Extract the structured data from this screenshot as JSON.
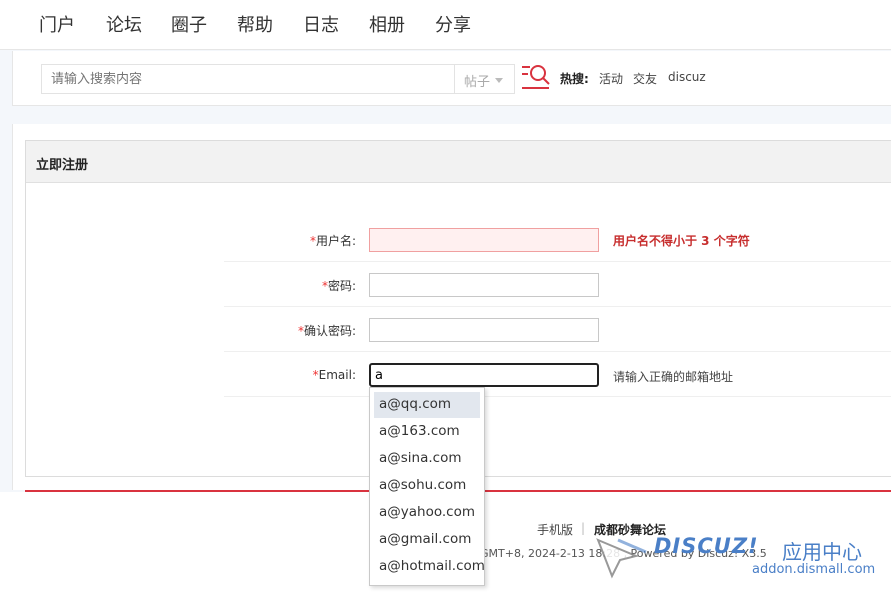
{
  "nav": {
    "items": [
      {
        "label": "门户"
      },
      {
        "label": "论坛"
      },
      {
        "label": "圈子"
      },
      {
        "label": "帮助"
      },
      {
        "label": "日志"
      },
      {
        "label": "相册"
      },
      {
        "label": "分享"
      }
    ]
  },
  "search": {
    "placeholder": "请输入搜索内容",
    "type": "帖子",
    "hot_label": "热搜:",
    "hot_links": [
      "活动",
      "交友",
      "discuz"
    ]
  },
  "register": {
    "title": "立即注册",
    "username": {
      "required": "*",
      "label": "用户名:",
      "value": "",
      "error": "用户名不得小于 3 个字符"
    },
    "password": {
      "required": "*",
      "label": "密码:",
      "value": ""
    },
    "confirm": {
      "required": "*",
      "label": "确认密码:",
      "value": ""
    },
    "email": {
      "required": "*",
      "label": "Email:",
      "value": "a",
      "tip": "请输入正确的邮箱地址"
    }
  },
  "email_suggestions": [
    "a@qq.com",
    "a@163.com",
    "a@sina.com",
    "a@sohu.com",
    "a@yahoo.com",
    "a@gmail.com",
    "a@hotmail.com"
  ],
  "footer": {
    "mobile": "手机版",
    "sep": "|",
    "site": "成都砂舞论坛",
    "meta": "GMT+8, 2024-2-13 18:28 , Powered by Discuz! X3.5"
  },
  "watermark": {
    "brand": "DISCUZ!",
    "cn": "应用中心",
    "url": "addon.dismall.com"
  },
  "colors": {
    "accent_red": "#d9333f",
    "error_red": "#c72e2e",
    "brand_blue": "#4a7fc7"
  }
}
